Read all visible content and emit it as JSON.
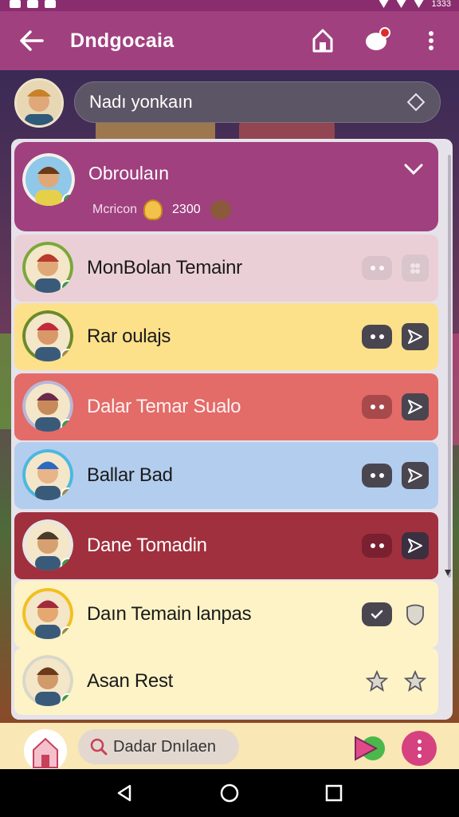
{
  "status_bar": {
    "time": "1333"
  },
  "app_bar": {
    "title": "Dndgocaia"
  },
  "search": {
    "placeholder": "Nadı yonkaın"
  },
  "profile": {
    "name": "Obroulaın",
    "sub_label": "Mcricon",
    "points": "2300"
  },
  "contacts": [
    {
      "name": "MonBolan Temainr",
      "bg": "#ebcfd7",
      "text": "#1a1a1a",
      "chat_bg": "#d6c0c8",
      "act_bg": "#d9c6cc",
      "act_icon": "group-icon",
      "muted": true
    },
    {
      "name": "Rar oulajs",
      "bg": "#fde08a",
      "text": "#1a1a1a",
      "chat_bg": "#4a4650",
      "act_bg": "#4a4650",
      "act_icon": "send-icon"
    },
    {
      "name": "Dalar Temar Sualo",
      "bg": "#e36b68",
      "text": "#fdf1f1",
      "chat_bg": "#a84a4c",
      "act_bg": "#4a4650",
      "act_icon": "send-icon"
    },
    {
      "name": "Ballar Bad",
      "bg": "#b3cdee",
      "text": "#1a1a1a",
      "chat_bg": "#4a4650",
      "act_bg": "#4a4650",
      "act_icon": "send-icon"
    },
    {
      "name": "Dane Tomadin",
      "bg": "#a0303e",
      "text": "#ffffff",
      "chat_bg": "#7a2030",
      "act_bg": "#3a3040",
      "act_icon": "send-icon"
    },
    {
      "name": "Daın Temain lanpas",
      "bg": "#fef3c6",
      "text": "#1a1a1a",
      "chat_bg": "#4a4650",
      "act_bg": "#fef3c6",
      "act_icon": "shield-icon",
      "check": true
    },
    {
      "name": "Asan Rest",
      "bg": "#fef3c6",
      "text": "#1a1a1a",
      "chat_bg": "#fef3c6",
      "act_bg": "#fef3c6",
      "act_icon": "star-icon",
      "star": true
    }
  ],
  "bottom_bar": {
    "search_label": "Dadar Dnılaen"
  },
  "colors": {
    "primary": "#a0407f",
    "accent": "#d6417f"
  }
}
